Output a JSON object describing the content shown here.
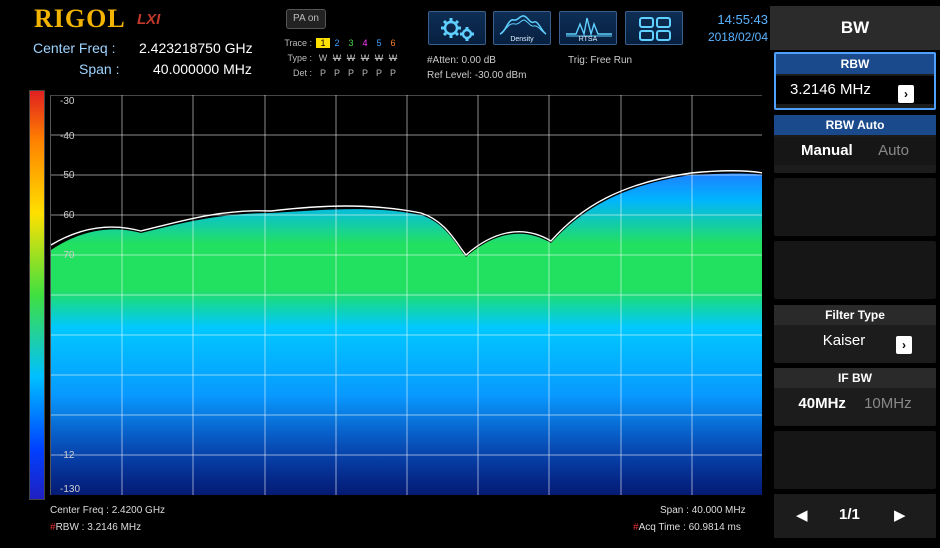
{
  "header": {
    "logo": "RIGOL",
    "logo_sub": "LXI",
    "center_freq_label": "Center Freq :",
    "center_freq_value": "2.423218750 GHz",
    "span_label": "Span :",
    "span_value": "40.000000 MHz",
    "pa_button": "PA on",
    "trace": {
      "trace_label": "Trace :",
      "type_label": "Type :",
      "det_label": "Det :",
      "numbers": [
        "1",
        "2",
        "3",
        "4",
        "5",
        "6"
      ],
      "number_colors": [
        "#000000",
        "#3da0ff",
        "#4cd64c",
        "#ff40ff",
        "#40a0ff",
        "#ff8030"
      ],
      "types": [
        "W",
        "W",
        "W",
        "W",
        "W",
        "W"
      ],
      "dets": [
        "P",
        "P",
        "P",
        "P",
        "P",
        "P"
      ]
    },
    "atten": "#Atten: 0.00 dB",
    "ref_level": "Ref Level: -30.00 dBm",
    "trig": "Trig: Free Run",
    "icons": {
      "density_label": "Density",
      "rtsa_label": "RTSA"
    },
    "time": "14:55:43",
    "date": "2018/02/04"
  },
  "plot": {
    "y_ticks": [
      "-30",
      "-40",
      "-50",
      "-60",
      "-70",
      "-12",
      "-130"
    ],
    "colors": {
      "green": "#22e060",
      "cyan": "#00c8ff",
      "blue": "#0a55ff"
    }
  },
  "footer": {
    "center_freq": "Center Freq : 2.4200 GHz",
    "rbw_prefix": "#",
    "rbw": "RBW : 3.2146 MHz",
    "span": "Span : 40.000 MHz",
    "acq_prefix": "#",
    "acq": "Acq Time : 60.9814 ms"
  },
  "menu": {
    "title": "BW",
    "rbw_label": "RBW",
    "rbw_value": "3.2146 MHz",
    "rbw_auto_label": "RBW Auto",
    "rbw_auto_manual": "Manual",
    "rbw_auto_auto": "Auto",
    "filter_type_label": "Filter Type",
    "filter_type_value": "Kaiser",
    "if_bw_label": "IF BW",
    "if_bw_opt1": "40MHz",
    "if_bw_opt2": "10MHz",
    "page": "1/1"
  }
}
